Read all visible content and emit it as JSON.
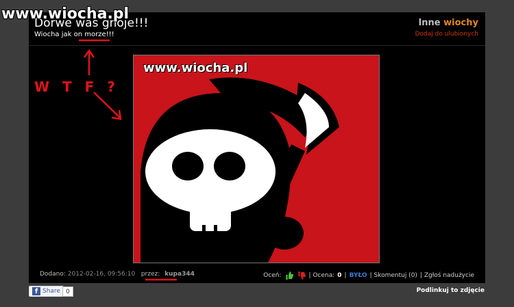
{
  "watermark": "www.wiocha.pl",
  "post": {
    "title": "Dorwe was gnoje!!!",
    "subtitle": "Wiocha jak on morze!!!"
  },
  "side": {
    "inne_prefix": "Inne",
    "inne_accent": "wiochy",
    "add_favorites": "Dodaj do ulubionych"
  },
  "image": {
    "url_text": "www.wiocha.pl",
    "background": "#c8141a"
  },
  "annotations": {
    "wtf": "W T F ?"
  },
  "footer": {
    "added_label": "Dodano:",
    "added_value": "2012-02-16, 09:56:10",
    "by_label": "przez:",
    "author": "kupa344",
    "rate_label": "Oceń:",
    "rating_label": "| Ocena:",
    "rating_value": "0",
    "byl": "BYŁO",
    "comment": "| Skomentuj (0)",
    "report": "| Zgłoś nadużycie"
  },
  "share": {
    "label": "Share",
    "count": "0"
  },
  "link_photo": "Podlinkuj to zdjęcie"
}
